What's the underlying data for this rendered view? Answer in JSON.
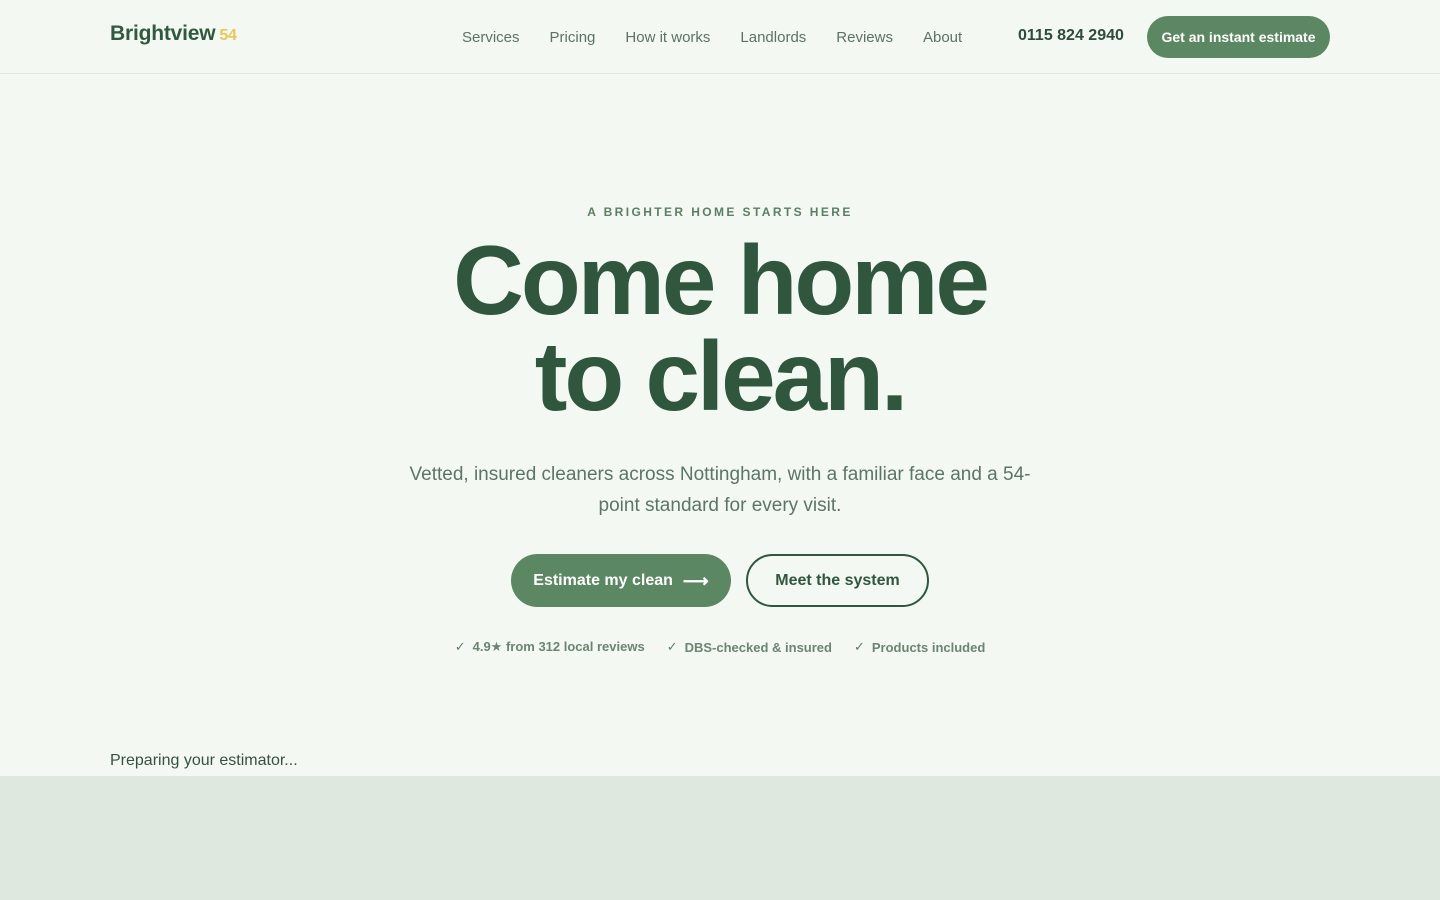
{
  "header": {
    "brand_name": "Brightview",
    "brand_number": "54",
    "nav": [
      {
        "label": "Services"
      },
      {
        "label": "Pricing"
      },
      {
        "label": "How it works"
      },
      {
        "label": "Landlords"
      },
      {
        "label": "Reviews"
      },
      {
        "label": "About"
      }
    ],
    "phone": "0115 824 2940",
    "cta_label": "Get an instant estimate"
  },
  "hero": {
    "eyebrow": "A BRIGHTER HOME STARTS HERE",
    "headline_line1": "Come home",
    "headline_line2": "to clean.",
    "subtext": "Vetted, insured cleaners across Nottingham, with a familiar face and a 54-point standard for every visit.",
    "primary_cta": "Estimate my clean",
    "primary_cta_icon": "arrow-right-icon",
    "secondary_cta": "Meet the system",
    "trust_items": [
      {
        "icon": "check-icon",
        "label": "4.9★ from 312 local reviews"
      },
      {
        "icon": "check-icon",
        "label": "DBS-checked & insured"
      },
      {
        "icon": "check-icon",
        "label": "Products included"
      }
    ]
  },
  "estimator": {
    "status": "Preparing your estimator..."
  },
  "colors": {
    "background": "#f3f8f2",
    "brand_green": "#30573d",
    "button_green": "#5c8763",
    "brand_accent": "#e7c85a",
    "panel": "#dfe8de"
  }
}
